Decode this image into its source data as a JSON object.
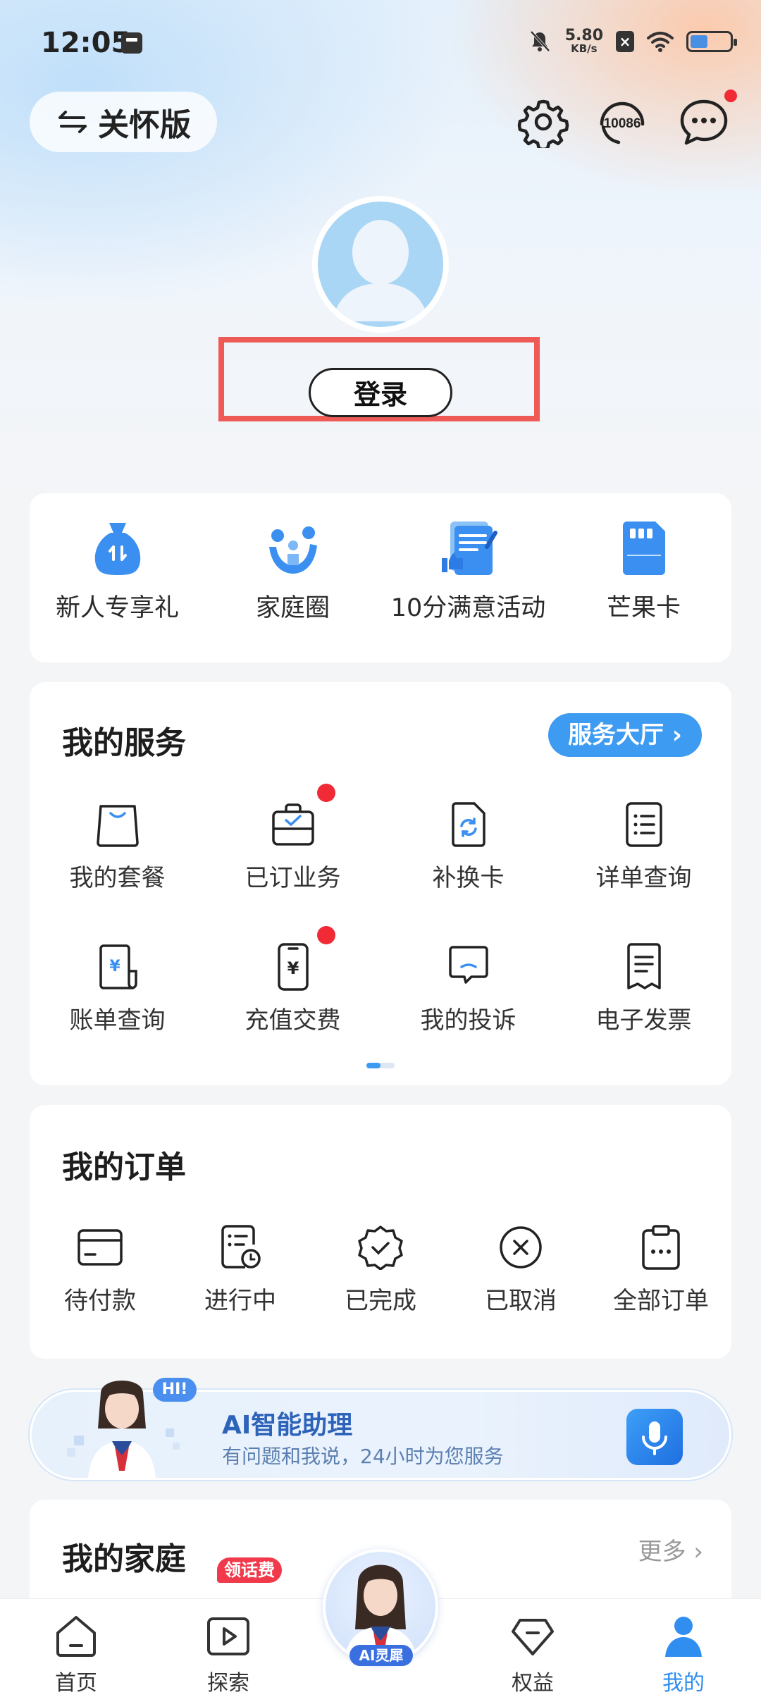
{
  "status_bar": {
    "time": "12:05",
    "speed_value": "5.80",
    "speed_unit": "KB/s"
  },
  "header": {
    "care_mode_label": "关怀版",
    "hotline_number": "10086"
  },
  "profile": {
    "login_label": "登录"
  },
  "quick_links": [
    {
      "label": "新人专享礼",
      "icon": "gift-bag-icon"
    },
    {
      "label": "家庭圈",
      "icon": "family-icon"
    },
    {
      "label": "10分满意活动",
      "icon": "survey-icon"
    },
    {
      "label": "芒果卡",
      "icon": "mango-card-icon"
    }
  ],
  "services": {
    "title": "我的服务",
    "hall_label": "服务大厅 ›",
    "items": [
      {
        "label": "我的套餐",
        "icon": "shopping-bag-icon"
      },
      {
        "label": "已订业务",
        "icon": "subscribed-icon"
      },
      {
        "label": "补换卡",
        "icon": "sim-swap-icon"
      },
      {
        "label": "详单查询",
        "icon": "detail-list-icon"
      },
      {
        "label": "账单查询",
        "icon": "bill-icon"
      },
      {
        "label": "充值交费",
        "icon": "recharge-icon"
      },
      {
        "label": "我的投诉",
        "icon": "complaint-icon"
      },
      {
        "label": "电子发票",
        "icon": "invoice-icon"
      }
    ]
  },
  "orders": {
    "title": "我的订单",
    "items": [
      {
        "label": "待付款",
        "icon": "card-icon"
      },
      {
        "label": "进行中",
        "icon": "in-progress-icon"
      },
      {
        "label": "已完成",
        "icon": "completed-icon"
      },
      {
        "label": "已取消",
        "icon": "cancelled-icon"
      },
      {
        "label": "全部订单",
        "icon": "all-orders-icon"
      }
    ]
  },
  "ai_banner": {
    "bubble": "HI!",
    "title": "AI智能助理",
    "subtitle": "有问题和我说，24小时为您服务"
  },
  "family": {
    "title": "我的家庭",
    "more_label": "更多 ›"
  },
  "tabbar": {
    "badge": "领话费",
    "ai_tag": "AI灵犀",
    "tabs": [
      {
        "label": "首页",
        "icon": "home-icon"
      },
      {
        "label": "探索",
        "icon": "explore-icon"
      },
      {
        "label": "权益",
        "icon": "benefits-icon"
      },
      {
        "label": "我的",
        "icon": "profile-icon"
      }
    ]
  },
  "colors": {
    "accent": "#3d9bf2",
    "highlight_box": "#ee5a55",
    "badge_red": "#f02b35"
  }
}
